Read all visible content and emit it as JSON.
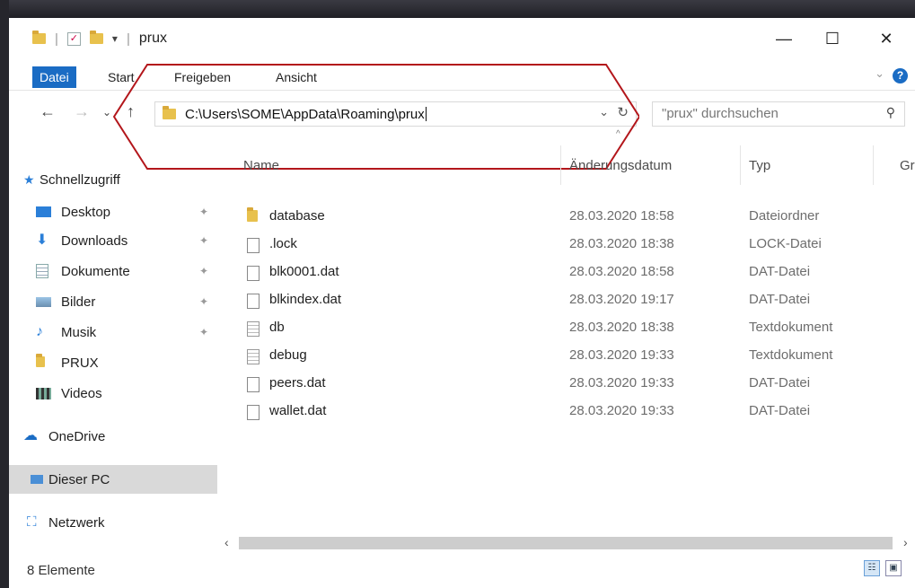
{
  "window": {
    "title": "prux"
  },
  "ribbon": {
    "tabs": [
      "Datei",
      "Start",
      "Freigeben",
      "Ansicht"
    ]
  },
  "address": {
    "path": "C:\\Users\\SOME\\AppData\\Roaming\\prux",
    "search_placeholder": "\"prux\" durchsuchen"
  },
  "sidebar": {
    "quick_access": "Schnellzugriff",
    "items": [
      {
        "label": "Desktop",
        "icon": "desktop-icon",
        "pinned": true
      },
      {
        "label": "Downloads",
        "icon": "download-icon",
        "pinned": true
      },
      {
        "label": "Dokumente",
        "icon": "documents-icon",
        "pinned": true
      },
      {
        "label": "Bilder",
        "icon": "pictures-icon",
        "pinned": true
      },
      {
        "label": "Musik",
        "icon": "music-icon",
        "pinned": true
      },
      {
        "label": "PRUX",
        "icon": "folder-icon",
        "pinned": false
      },
      {
        "label": "Videos",
        "icon": "videos-icon",
        "pinned": false
      }
    ],
    "onedrive": "OneDrive",
    "this_pc": "Dieser PC",
    "network": "Netzwerk"
  },
  "columns": {
    "name": "Name",
    "date": "Änderungsdatum",
    "type": "Typ",
    "size": "Gr"
  },
  "files": [
    {
      "name": "database",
      "date": "28.03.2020 18:58",
      "type": "Dateiordner",
      "icon": "folder-icon"
    },
    {
      "name": ".lock",
      "date": "28.03.2020 18:38",
      "type": "LOCK-Datei",
      "icon": "file-icon"
    },
    {
      "name": "blk0001.dat",
      "date": "28.03.2020 18:58",
      "type": "DAT-Datei",
      "icon": "file-icon"
    },
    {
      "name": "blkindex.dat",
      "date": "28.03.2020 19:17",
      "type": "DAT-Datei",
      "icon": "file-icon"
    },
    {
      "name": "db",
      "date": "28.03.2020 18:38",
      "type": "Textdokument",
      "icon": "text-file-icon"
    },
    {
      "name": "debug",
      "date": "28.03.2020 19:33",
      "type": "Textdokument",
      "icon": "text-file-icon"
    },
    {
      "name": "peers.dat",
      "date": "28.03.2020 19:33",
      "type": "DAT-Datei",
      "icon": "file-icon"
    },
    {
      "name": "wallet.dat",
      "date": "28.03.2020 19:33",
      "type": "DAT-Datei",
      "icon": "file-icon"
    }
  ],
  "status": {
    "count": "8 Elemente"
  },
  "colors": {
    "accent": "#1a6cc4",
    "callout": "#b3161b",
    "folder": "#e8c14d"
  }
}
